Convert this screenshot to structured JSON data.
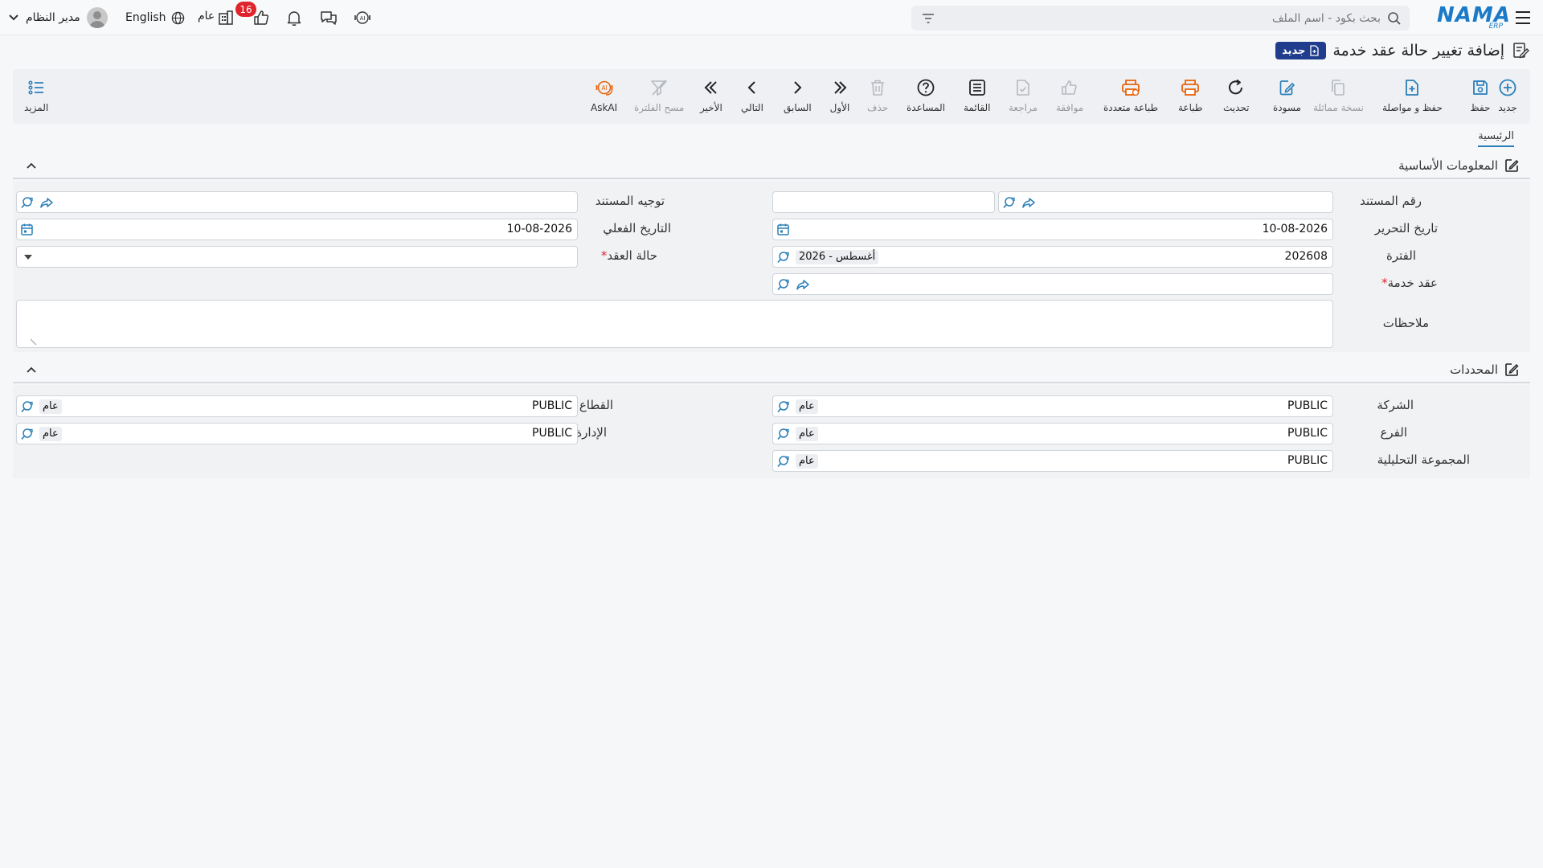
{
  "header": {
    "user_name": "مدير النظام",
    "language": "English",
    "org_label": "عام",
    "notification_count": "16",
    "search_placeholder": "بحث بكود - اسم الملف",
    "logo_text": "NAMA",
    "logo_sub": "ERP"
  },
  "page": {
    "title": "إضافة تغيير حالة عقد خدمة",
    "new_badge": "جديد"
  },
  "toolbar": {
    "new": "جديد",
    "save": "حفظ",
    "save_continue": "حفظ و مواصلة",
    "duplicate": "نسخة مماثلة",
    "draft": "مسودة",
    "refresh": "تحديث",
    "print": "طباعة",
    "multi_print": "طباعة متعددة",
    "approve": "موافقة",
    "review": "مراجعة",
    "list": "القائمة",
    "help": "المساعدة",
    "delete": "حذف",
    "first": "الأول",
    "previous": "السابق",
    "next": "التالي",
    "last": "الأخير",
    "clear_filter": "مسح الفلترة",
    "askai": "AskAI",
    "more": "المزيد"
  },
  "tabs": {
    "main": "الرئيسية"
  },
  "basic_info": {
    "section_title": "المعلومات الأساسية",
    "doc_number_label": "رقم المستند",
    "doc_number_value": "",
    "doc_direction_label": "توجيه المستند",
    "issue_date_label": "تاريخ التحرير",
    "issue_date_value": "10-08-2026",
    "actual_date_label": "التاريخ الفعلي",
    "actual_date_value": "10-08-2026",
    "period_label": "الفترة",
    "period_value": "202608",
    "period_name": "2026 - أغسطس",
    "contract_status_label": "حالة العقد",
    "service_contract_label": "عقد خدمة",
    "notes_label": "ملاحظات"
  },
  "dimensions": {
    "section_title": "المحددات",
    "company_label": "الشركة",
    "company_value": "PUBLIC",
    "company_name": "عام",
    "sector_label": "القطاع",
    "sector_value": "PUBLIC",
    "sector_name": "عام",
    "branch_label": "الفرع",
    "branch_value": "PUBLIC",
    "branch_name": "عام",
    "department_label": "الإدارة",
    "department_value": "PUBLIC",
    "department_name": "عام",
    "analytic_group_label": "المجموعة التحليلية",
    "analytic_group_value": "PUBLIC",
    "analytic_group_name": "عام"
  },
  "colors": {
    "accent": "#2b7fb9",
    "brand": "#1a7ac7",
    "badge": "#1f3d8c",
    "notification": "#e0242c",
    "print_orange": "#e8630a"
  }
}
